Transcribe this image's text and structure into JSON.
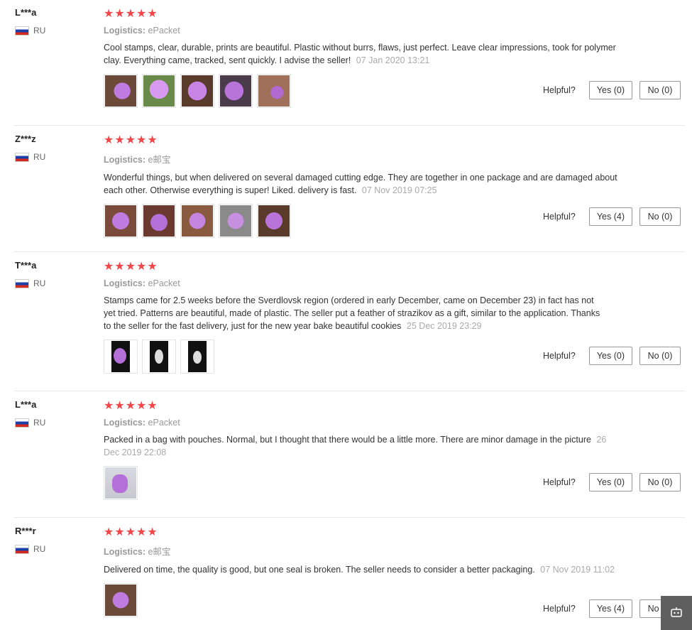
{
  "helpful_label": "Helpful?",
  "star_glyphs": "★★★★★",
  "logistics_label": "Logistics:",
  "reviews": [
    {
      "user": "L***a",
      "country": "RU",
      "stars": 5,
      "logistics": "ePacket",
      "text": "Cool stamps, clear, durable, prints are beautiful. Plastic without burrs, flaws, just perfect. Leave clear impressions, took for polymer clay. Everything came, tracked, sent quickly. I advise the seller!",
      "date": "07 Jan 2020 13:21",
      "yes": "Yes (0)",
      "no": "No (0)"
    },
    {
      "user": "Z***z",
      "country": "RU",
      "stars": 5,
      "logistics": "e邮宝",
      "text": "Wonderful things, but when delivered on several damaged cutting edge. They are together in one package and are damaged about each other. Otherwise everything is super! Liked. delivery is fast.",
      "date": "07 Nov 2019 07:25",
      "yes": "Yes (4)",
      "no": "No (0)"
    },
    {
      "user": "T***a",
      "country": "RU",
      "stars": 5,
      "logistics": "ePacket",
      "text": "Stamps came for 2.5 weeks before the Sverdlovsk region (ordered in early December, came on December 23) in fact has not yet tried. Patterns are beautiful, made of plastic. The seller put a feather of strazikov as a gift, similar to the application. Thanks to the seller for the fast delivery, just for the new year bake beautiful cookies",
      "date": "25 Dec 2019 23:29",
      "yes": "Yes (0)",
      "no": "No (0)"
    },
    {
      "user": "L***a",
      "country": "RU",
      "stars": 5,
      "logistics": "ePacket",
      "text": "Packed in a bag with pouches. Normal, but I thought that there would be a little more. There are minor damage in the picture",
      "date": "26 Dec 2019 22:08",
      "yes": "Yes (0)",
      "no": "No (0)"
    },
    {
      "user": "R***r",
      "country": "RU",
      "stars": 5,
      "logistics": "e邮宝",
      "text": "Delivered on time, the quality is good, but one seal is broken. The seller needs to consider a better packaging.",
      "date": "07 Nov 2019 11:02",
      "yes": "Yes (4)",
      "no": "No (0)"
    }
  ],
  "colors": {
    "star": "#f0484a",
    "muted": "#999999",
    "photo_purple": "#b46fd6"
  }
}
